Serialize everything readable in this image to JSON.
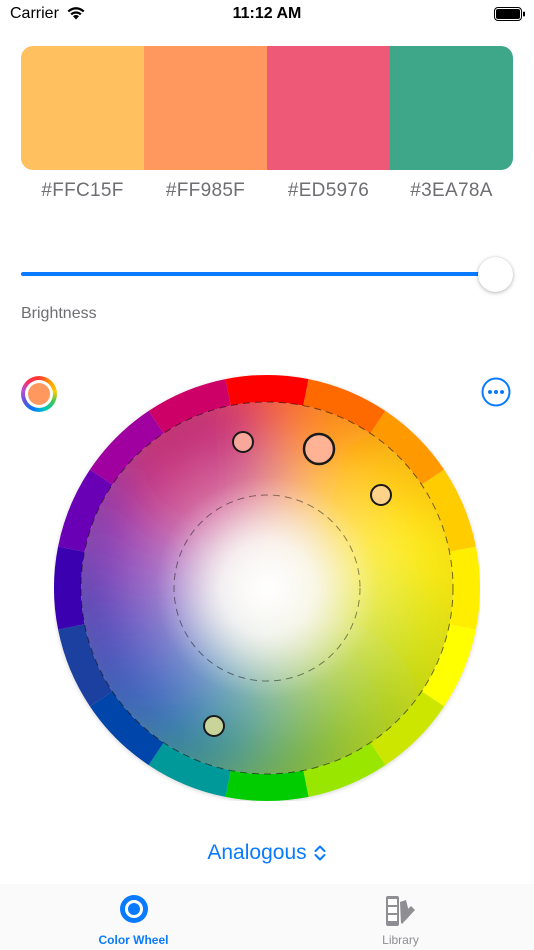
{
  "status_bar": {
    "carrier": "Carrier",
    "time": "11:12 AM"
  },
  "palette": {
    "swatches": [
      {
        "hex": "#FFC15F",
        "color": "#FFC15F"
      },
      {
        "hex": "#FF985F",
        "color": "#FF985F"
      },
      {
        "hex": "#ED5976",
        "color": "#ED5976"
      },
      {
        "hex": "#3EA78A",
        "color": "#3EA78A"
      }
    ]
  },
  "brightness": {
    "label": "Brightness",
    "value": 1.0
  },
  "toolbar": {
    "left_icon": "color-swatch-icon",
    "right_icon": "ellipsis-circle-icon"
  },
  "harmony": {
    "label": "Analogous"
  },
  "tabs": [
    {
      "label": "Color Wheel",
      "icon": "color-wheel-icon",
      "selected": true
    },
    {
      "label": "Library",
      "icon": "swatch-book-icon",
      "selected": false
    }
  ],
  "colors": {
    "accent": "#0A7BFF",
    "selected_swatch": "#FF985F"
  }
}
